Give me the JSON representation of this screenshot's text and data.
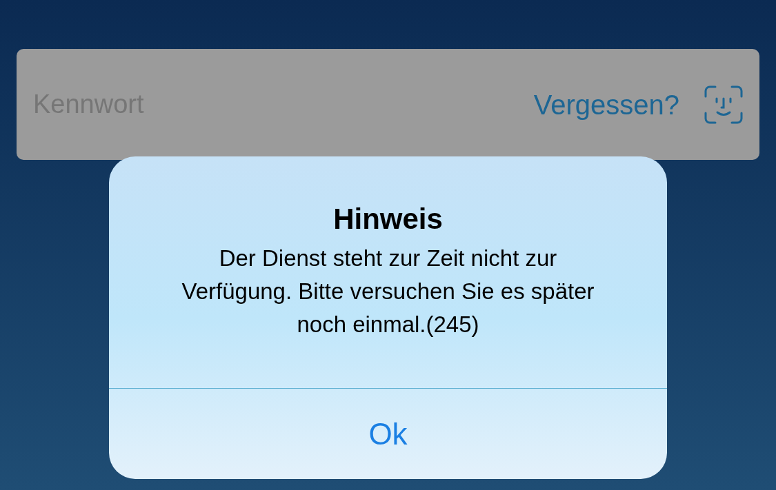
{
  "password_field": {
    "placeholder": "Kennwort",
    "link": "Vergessen?"
  },
  "alert": {
    "title": "Hinweis",
    "message": "Der Dienst steht zur Zeit nicht zur Verfügung. Bitte versuchen Sie es später noch einmal.(245)",
    "buttons": [
      "Ok"
    ]
  }
}
